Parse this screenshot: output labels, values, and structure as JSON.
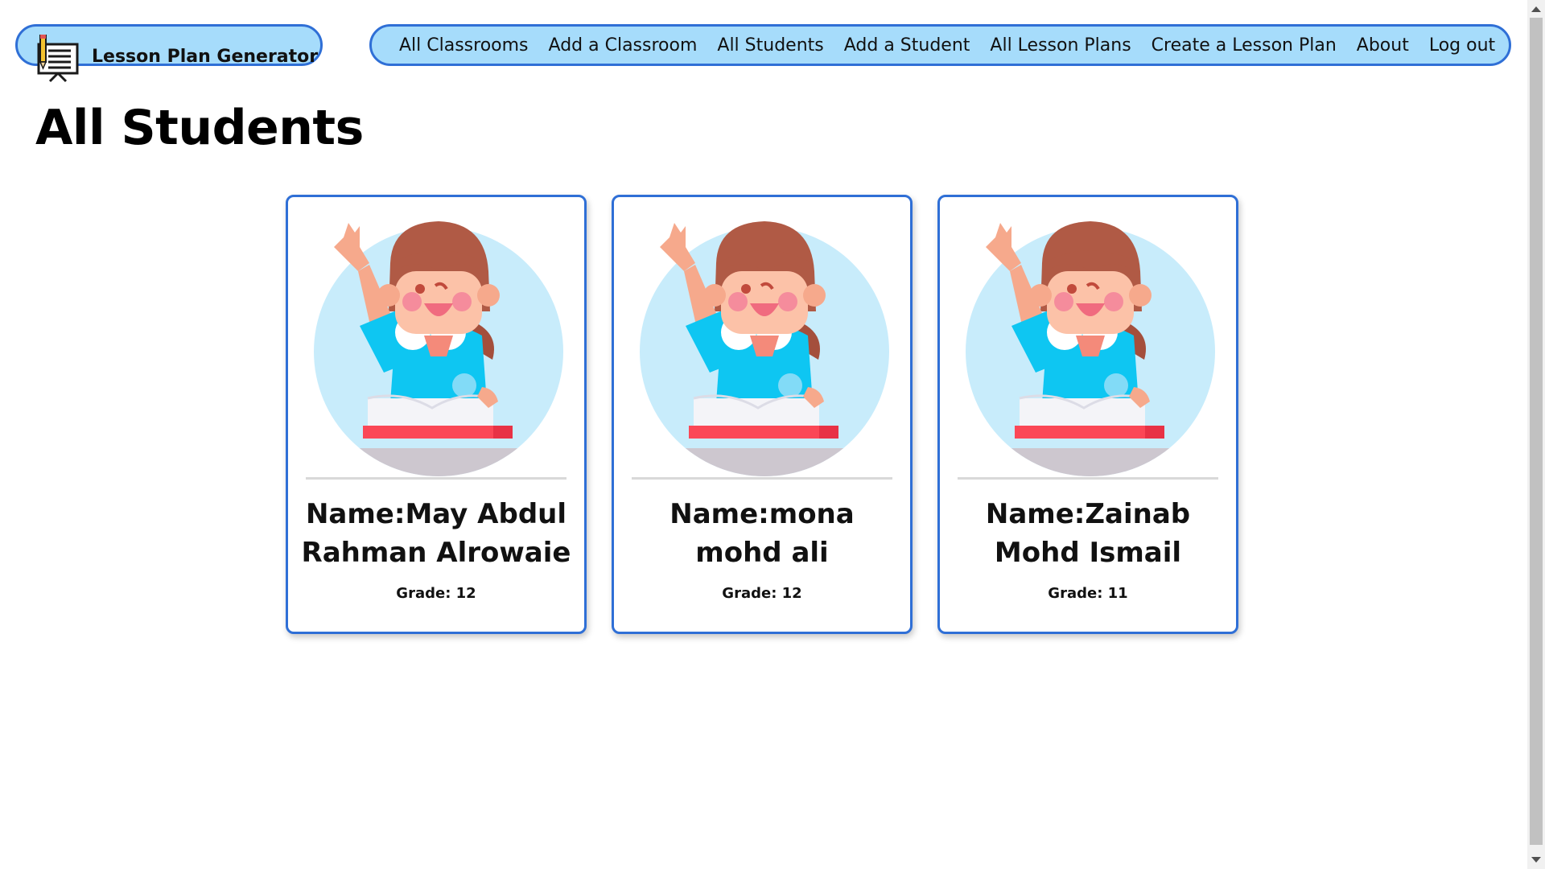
{
  "brand": {
    "title": "Lesson Plan Generator",
    "icon": "lesson-plan-board-icon"
  },
  "nav": {
    "items": [
      {
        "label": "All Classrooms"
      },
      {
        "label": "Add a Classroom"
      },
      {
        "label": "All Students"
      },
      {
        "label": "Add a Student"
      },
      {
        "label": "All Lesson Plans"
      },
      {
        "label": "Create a Lesson Plan"
      },
      {
        "label": "About"
      },
      {
        "label": "Log out"
      }
    ]
  },
  "page": {
    "title": "All Students"
  },
  "students": [
    {
      "name": "Name:May Abdul Rahman Alrowaie",
      "grade": "Grade: 12",
      "avatar": "student-raising-hand-avatar"
    },
    {
      "name": "Name:mona mohd ali",
      "grade": "Grade: 12",
      "avatar": "student-raising-hand-avatar"
    },
    {
      "name": "Name:Zainab Mohd Ismail",
      "grade": "Grade: 11",
      "avatar": "student-raising-hand-avatar"
    }
  ],
  "colors": {
    "nav_bg": "#a6dcfb",
    "accent_border": "#2f6fd6"
  }
}
